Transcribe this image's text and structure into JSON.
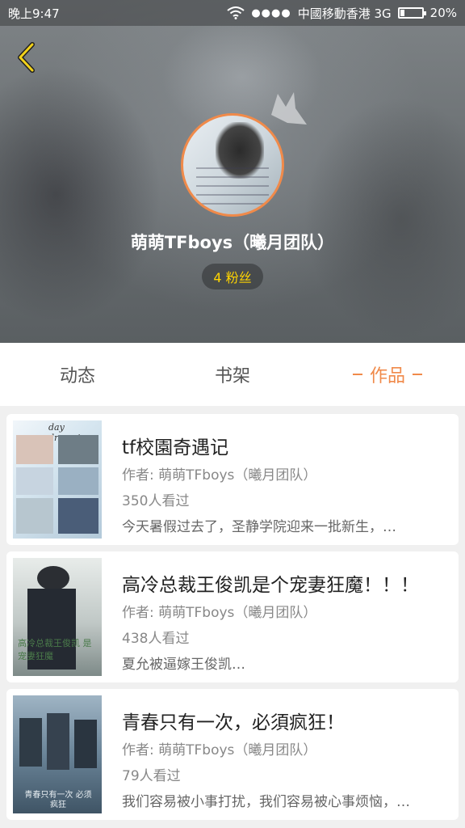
{
  "status_bar": {
    "time": "晚上9:47",
    "signal_dots": "●●●●",
    "carrier": "中國移動香港 3G",
    "battery_percent": "20%",
    "battery_level": 0.2
  },
  "profile": {
    "name": "萌萌TFboys（曦月团队）",
    "fans": "4 粉丝",
    "avatar_border_color": "#f08a4a"
  },
  "tabs": [
    {
      "label": "动态",
      "active": false
    },
    {
      "label": "书架",
      "active": false
    },
    {
      "label": "作品",
      "active": true
    }
  ],
  "accent_color": "#f08a4a",
  "works": [
    {
      "title": "tf校園奇遇记",
      "author": "作者: 萌萌TFboys（曦月团队）",
      "views": "350人看过",
      "desc": "今天暑假过去了，圣静学院迎来一批新生，…",
      "cover_text": "day dreaming"
    },
    {
      "title": "高冷总裁王俊凯是个宠妻狂魔！！！",
      "author": "作者: 萌萌TFboys（曦月团队）",
      "views": "438人看过",
      "desc": "夏允被逼嫁王俊凯…",
      "cover_text": "高冷总裁王俊凯 是 宠妻狂魔"
    },
    {
      "title": "青春只有一次，必須疯狂！",
      "author": "作者: 萌萌TFboys（曦月团队）",
      "views": "79人看过",
      "desc": "我们容易被小事打扰，我们容易被心事烦恼，…",
      "cover_text": "青春只有一次 必须疯狂"
    }
  ]
}
